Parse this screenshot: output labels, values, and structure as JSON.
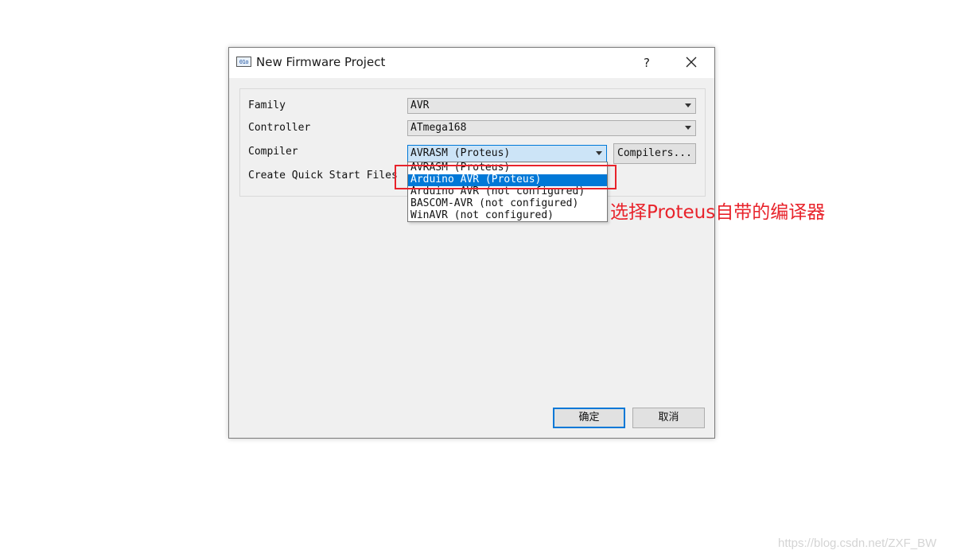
{
  "window": {
    "title": "New Firmware Project",
    "icon_text": "01o",
    "help_label": "?"
  },
  "form": {
    "family": {
      "label": "Family",
      "value": "AVR"
    },
    "controller": {
      "label": "Controller",
      "value": "ATmega168"
    },
    "compiler": {
      "label": "Compiler",
      "value": "AVRASM (Proteus)",
      "button_label": "Compilers..."
    },
    "quick_start": {
      "label": "Create Quick Start Files"
    }
  },
  "compiler_dropdown": {
    "options": [
      "AVRASM (Proteus)",
      "Arduino AVR (Proteus)",
      "Arduino AVR (not configured)",
      "BASCOM-AVR (not configured)",
      "WinAVR (not configured)"
    ],
    "selected": "Arduino AVR (Proteus)"
  },
  "buttons": {
    "ok_label": "确定",
    "cancel_label": "取消"
  },
  "annotation": {
    "text": "选择Proteus自带的编译器",
    "color": "#e8232b"
  },
  "watermark": "https://blog.csdn.net/ZXF_BW",
  "colors": {
    "accent": "#0078d7",
    "dialog_bg": "#f0f0f0"
  }
}
